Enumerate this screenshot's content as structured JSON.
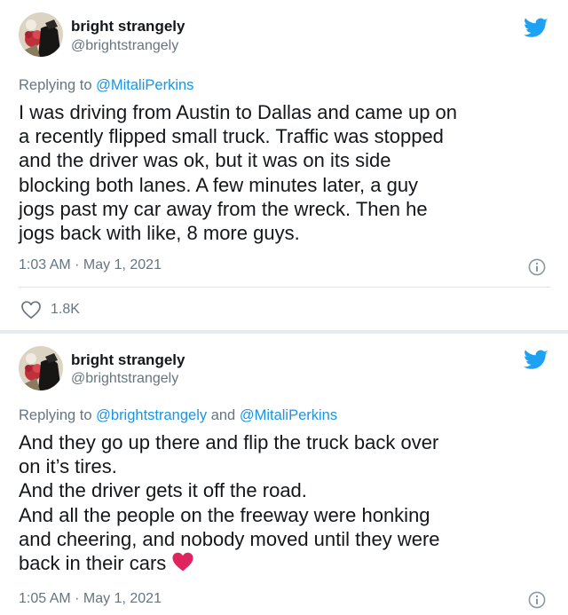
{
  "tweets": [
    {
      "author_name": "bright strangely",
      "author_handle": "@brightstrangely",
      "replying_prefix": "Replying to ",
      "replying_mentions": [
        "@MitaliPerkins"
      ],
      "text_lines": [
        "I was driving from Austin to Dallas and came up on",
        "a recently flipped small truck. Traffic was stopped",
        "and the driver was ok, but it was on its side",
        "blocking both lanes. A few minutes later, a guy",
        "jogs past my car away from the wreck. Then he",
        "jogs back with like, 8 more guys."
      ],
      "timestamp": "1:03 AM · May 1, 2021",
      "likes": "1.8K"
    },
    {
      "author_name": "bright strangely",
      "author_handle": "@brightstrangely",
      "replying_prefix": "Replying to ",
      "replying_mentions": [
        "@brightstrangely",
        "@MitaliPerkins"
      ],
      "replying_joiner": " and ",
      "text_lines": [
        "And they go up there and flip the truck back over",
        "on it’s tires.",
        "And the driver gets it off the road.",
        "And all the people on the freeway were honking",
        "and cheering, and nobody moved until they were",
        "back in their cars"
      ],
      "text_trailing_emoji": "red-heart-emoji",
      "timestamp": "1:05 AM · May 1, 2021"
    }
  ],
  "icons": {
    "platform": "twitter-bird-icon",
    "info": "info-icon",
    "like": "heart-outline-icon"
  },
  "colors": {
    "twitter_blue": "#1da1f2",
    "mention_blue": "#1b95e0",
    "secondary_text": "#66757f",
    "heart_red": "#e0245e"
  }
}
